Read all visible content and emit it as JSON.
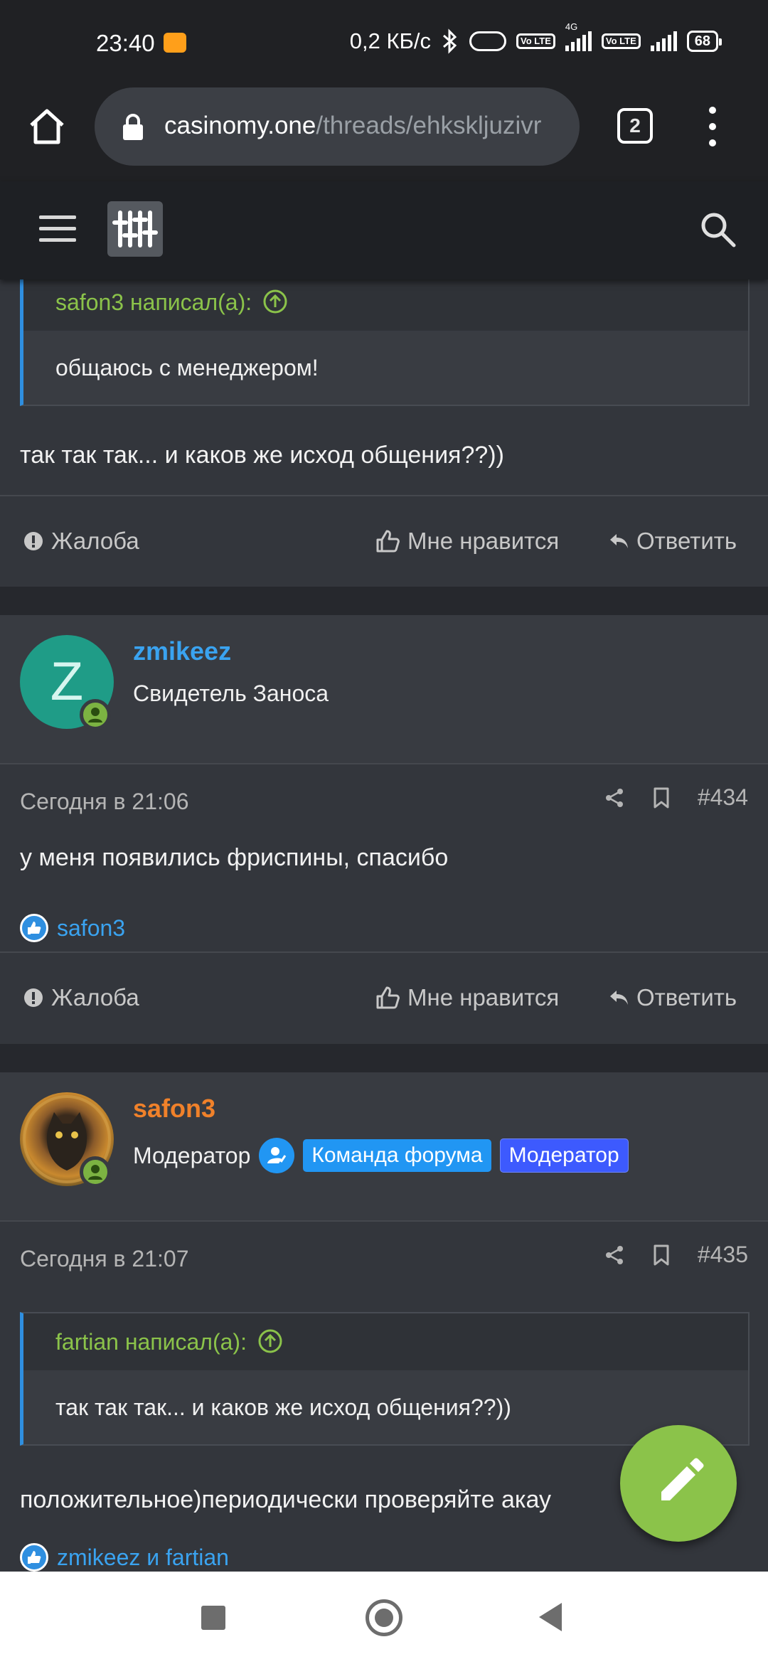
{
  "status_bar": {
    "time": "23:40",
    "speed": "0,2 КБ/с",
    "net_type": "4G",
    "volte1": "Vo LTE",
    "volte2": "Vo LTE",
    "battery": "68"
  },
  "browser": {
    "url_host": "casinomy.one",
    "url_path": "/threads/ehkskljuzivr",
    "tab_count": "2"
  },
  "colors": {
    "accent_green": "#8bc34a",
    "link_blue": "#3aa3f0",
    "moderator_orange": "#f0812a",
    "badge_team": "#2196f3",
    "badge_moderator": "#3d5afe"
  },
  "post1": {
    "quote_author": "safon3 написал(а):",
    "quote_text": "общаюсь с менеджером!",
    "message": "так так так... и каков же исход общения??))"
  },
  "actions": {
    "report": "Жалоба",
    "like": "Мне нравится",
    "reply": "Ответить"
  },
  "post2": {
    "username": "zmikeez",
    "avatar_letter": "Z",
    "user_title": "Свидетель Заноса",
    "date": "Сегодня в 21:06",
    "number": "#434",
    "message": "у меня появились фриспины, спасибо",
    "likes": "safon3"
  },
  "post3": {
    "username": "safon3",
    "user_title": "Модератор",
    "badge_team": "Команда форума",
    "badge_moderator": "Модератор",
    "date": "Сегодня в 21:07",
    "number": "#435",
    "quote_author": "fartian написал(а):",
    "quote_text": "так так так... и каков же исход общения??))",
    "message": "положительное)периодически проверяйте акау",
    "likes": "zmikeez и fartian"
  }
}
